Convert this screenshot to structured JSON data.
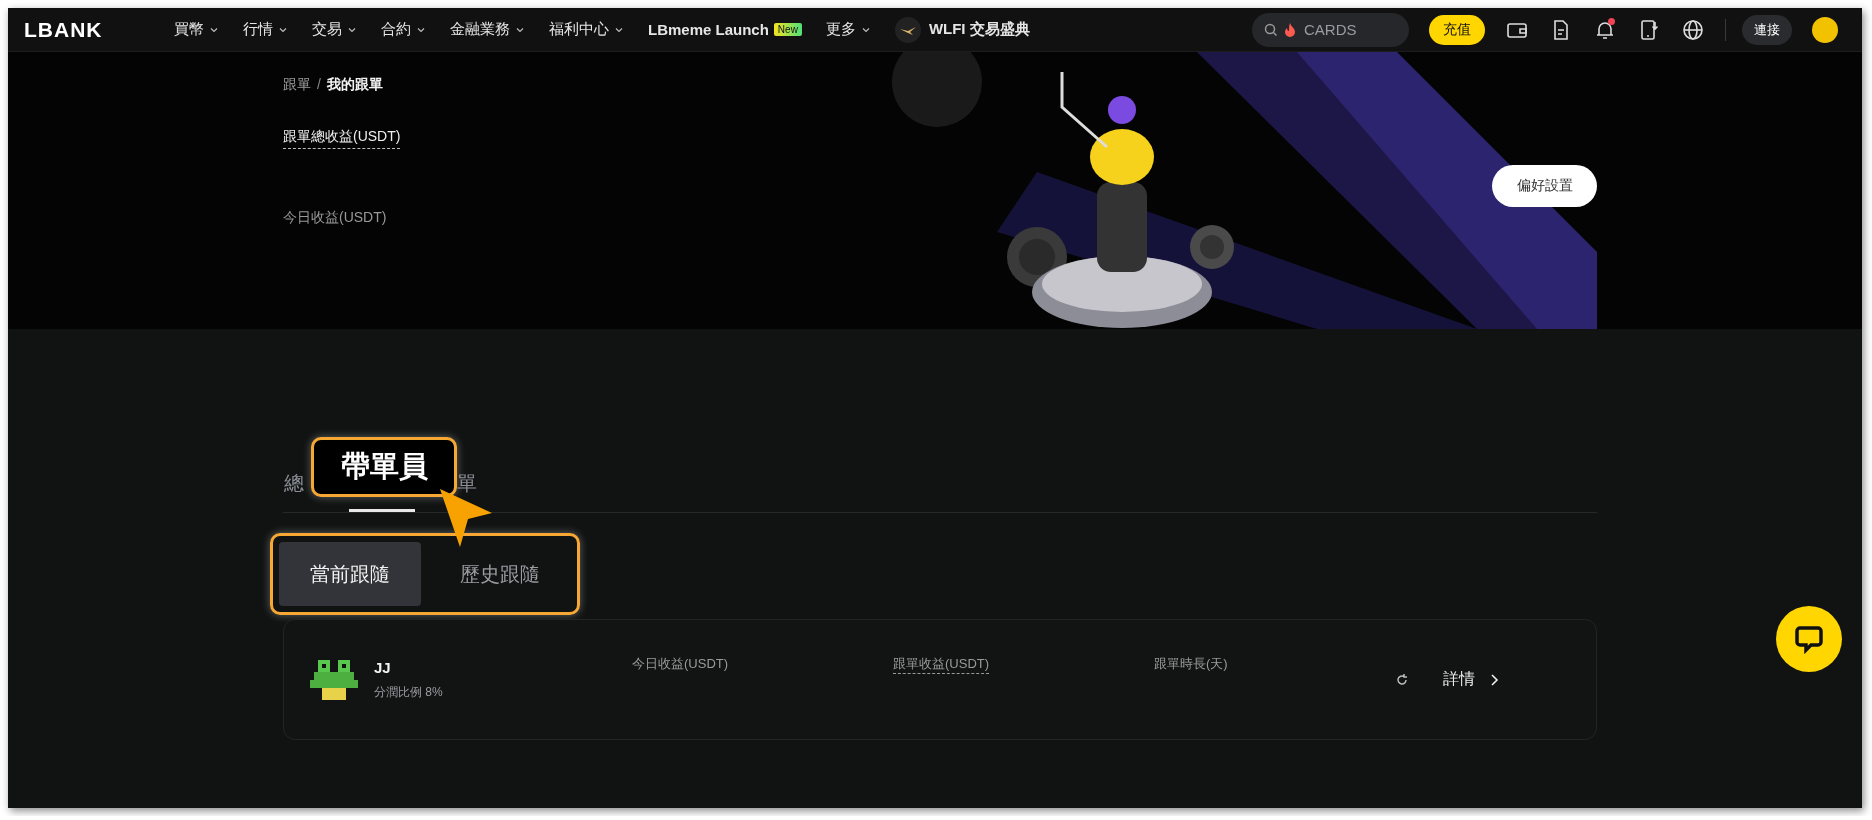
{
  "nav": {
    "logo": "LBANK",
    "items": [
      {
        "label": "買幣",
        "kind": "dropdown"
      },
      {
        "label": "行情",
        "kind": "dropdown"
      },
      {
        "label": "交易",
        "kind": "dropdown"
      },
      {
        "label": "合約",
        "kind": "dropdown"
      },
      {
        "label": "金融業務",
        "kind": "dropdown"
      },
      {
        "label": "福利中心",
        "kind": "dropdown"
      },
      {
        "label": "LBmeme Launch",
        "kind": "badge",
        "badge": "New"
      },
      {
        "label": "更多",
        "kind": "dropdown"
      },
      {
        "label": "WLFI 交易盛典",
        "kind": "promo"
      }
    ],
    "search": {
      "placeholder": "CARDS"
    },
    "deposit_button": "充值",
    "notification_unread": true,
    "connect_button": "連接"
  },
  "banner": {
    "breadcrumb": [
      "跟單",
      "我的跟單"
    ],
    "breadcrumb_separator": "/",
    "total_label": "跟單總收益(USDT)",
    "today_label": "今日收益(USDT)",
    "preferences_button": "偏好設置"
  },
  "tabs": [
    {
      "label": "總",
      "selected": false
    },
    {
      "selected": true
    },
    {
      "label": "單",
      "selected": false
    }
  ],
  "annotation": {
    "callout": "帶單員",
    "frame_segments": true
  },
  "segments": [
    {
      "label": "當前跟隨",
      "selected": true
    },
    {
      "label": "歷史跟隨",
      "selected": false
    }
  ],
  "follows": [
    {
      "name": "JJ",
      "share": "分潤比例 8%",
      "columns": [
        {
          "label": "今日收益(USDT)",
          "dotted": false
        },
        {
          "label": "跟單收益(USDT)",
          "dotted": true
        },
        {
          "label": "跟單時長(天)",
          "dotted": false
        }
      ],
      "detail": "詳情"
    }
  ]
}
